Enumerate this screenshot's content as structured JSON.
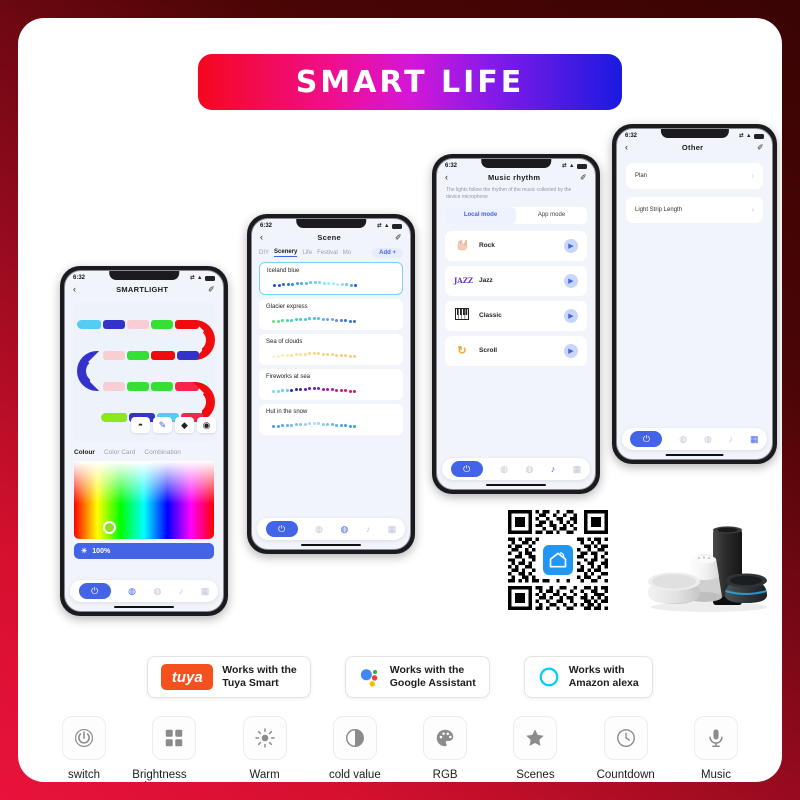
{
  "banner": {
    "title": "SMART LIFE"
  },
  "phone1": {
    "status": {
      "time": "6:32",
      "location_icon": "location-arrow-icon",
      "signal_icon": "signal-icon",
      "wifi_icon": "wifi-icon",
      "battery_icon": "battery-icon"
    },
    "nav": {
      "back": "‹",
      "title": "SMARTLIGHT",
      "edit": "✐"
    },
    "tools": [
      {
        "name": "paint-bucket-tool",
        "glyph": "◓",
        "active": false
      },
      {
        "name": "brush-tool",
        "glyph": "🖌",
        "active": true
      },
      {
        "name": "eraser-tool",
        "glyph": "◆",
        "active": false
      },
      {
        "name": "palette-tool",
        "glyph": "◉",
        "active": false
      }
    ],
    "tabs": [
      {
        "label": "Colour",
        "selected": true
      },
      {
        "label": "Color Card",
        "selected": false
      },
      {
        "label": "Combination",
        "selected": false
      }
    ],
    "brightness": {
      "icon": "sun-icon",
      "value": "100%"
    },
    "tabbar": [
      {
        "name": "power-button",
        "glyph": "⏻",
        "active": true
      },
      {
        "name": "bulb-icon",
        "glyph": "◍",
        "active": true
      },
      {
        "name": "palette-icon",
        "glyph": "◍",
        "active": false
      },
      {
        "name": "music-icon",
        "glyph": "♪",
        "active": false
      },
      {
        "name": "grid-icon",
        "glyph": "▦",
        "active": false
      }
    ],
    "strip_colors": [
      [
        "#55ccf2",
        "#3333cc",
        "#f9cdd3",
        "#33e033",
        "#f00c0c"
      ],
      [
        "#f9cdd3",
        "#33e033",
        "#f00c0c",
        "#3333cc"
      ],
      [
        "#f9cdd3",
        "#33e033",
        "#33e033",
        "#f4264a"
      ],
      [
        "#8ce81c",
        "#3333cc",
        "#55ccf2",
        "#f4264a"
      ]
    ]
  },
  "phone2": {
    "status": {
      "time": "6:32"
    },
    "nav": {
      "back": "‹",
      "title": "Scene",
      "edit": "✐"
    },
    "tabs": [
      {
        "label": "DIY",
        "selected": false
      },
      {
        "label": "Scenery",
        "selected": true
      },
      {
        "label": "Life",
        "selected": false
      },
      {
        "label": "Festival",
        "selected": false
      },
      {
        "label": "Mo",
        "selected": false
      }
    ],
    "add_label": "Add +",
    "scenes": [
      {
        "name": "Iceland blue",
        "selected": true,
        "colors": [
          "#1f4fd8",
          "#2356db",
          "#2a63de",
          "#2f72e2",
          "#3684e6",
          "#3f97ea",
          "#48a9ee",
          "#52bbf1",
          "#5dc8f3",
          "#69d4f5",
          "#76def6",
          "#84e6f7",
          "#92ecf8",
          "#a0f0f9",
          "#b0f4fa",
          "#8fd9f2",
          "#6cc0ea",
          "#49a7e2",
          "#2356db"
        ]
      },
      {
        "name": "Glacier express",
        "selected": false,
        "colors": [
          "#6fe07a",
          "#63dd85",
          "#57da92",
          "#4bd79f",
          "#45d4ac",
          "#40d1b9",
          "#3ecec6",
          "#40cbd2",
          "#45c6dc",
          "#4cc0e3",
          "#54b8e7",
          "#5fb0ea",
          "#6aa6ec",
          "#7a9cee",
          "#5c8ae8",
          "#4a7be4",
          "#3b6ee0",
          "#3b6ee0",
          "#3b6ee0"
        ]
      },
      {
        "name": "Sea of clouds",
        "selected": false,
        "colors": [
          "#fdf3cf",
          "#fcefc2",
          "#fbebb5",
          "#fbe7aa",
          "#fae4a1",
          "#fae199",
          "#f9de92",
          "#f9dc8c",
          "#f8d987",
          "#f8d783",
          "#f7d580",
          "#f7d47e",
          "#f6d27c",
          "#f6d17b",
          "#f5d07a",
          "#f5cf79",
          "#f4ce78",
          "#f4cd78",
          "#f3cc77"
        ]
      },
      {
        "name": "Fireworks at sea",
        "selected": false,
        "colors": [
          "#79dcf0",
          "#6fd6ee",
          "#63cfec",
          "#57c8ea",
          "#2a2ad0",
          "#2820cd",
          "#3a1fc9",
          "#4c1ec5",
          "#5f1dc1",
          "#711cbc",
          "#841bb8",
          "#961ab3",
          "#a919ae",
          "#bb18a8",
          "#c4179c",
          "#cc168c",
          "#d4157a",
          "#dc1465",
          "#e31350"
        ]
      },
      {
        "name": "Hut in the snow",
        "selected": false,
        "colors": [
          "#3f9be0",
          "#49a3e3",
          "#54abe6",
          "#5fb3e9",
          "#6bbbeb",
          "#78c3ed",
          "#86caef",
          "#94d1f1",
          "#a3d8f3",
          "#b2def4",
          "#a0d6f1",
          "#8ecdee",
          "#7cc4eb",
          "#6abbe8",
          "#58b2e5",
          "#46a9e2",
          "#3ba0df",
          "#3ba0df",
          "#3ba0df"
        ]
      }
    ],
    "tabbar": [
      {
        "name": "power-button",
        "glyph": "⏻",
        "active": true
      },
      {
        "name": "bulb-icon",
        "glyph": "◍",
        "active": false
      },
      {
        "name": "palette-icon",
        "glyph": "◍",
        "active": true
      },
      {
        "name": "music-icon",
        "glyph": "♪",
        "active": false
      },
      {
        "name": "grid-icon",
        "glyph": "▦",
        "active": false
      }
    ]
  },
  "phone3": {
    "status": {
      "time": "6:32"
    },
    "nav": {
      "back": "‹",
      "title": "Music rhythm",
      "edit": "✐"
    },
    "description": "The lights follow the rhythm of the music collected by the device microphone",
    "modes": [
      {
        "label": "Local mode",
        "selected": true
      },
      {
        "label": "App mode",
        "selected": false
      }
    ],
    "items": [
      {
        "name": "Rock",
        "icon": "rock-hand-icon",
        "glyph": "🤘",
        "play": "▶"
      },
      {
        "name": "Jazz",
        "icon": "jazz-text-icon",
        "glyph": "JAZZ",
        "play": "▶"
      },
      {
        "name": "Classic",
        "icon": "piano-icon",
        "glyph": "🎹",
        "play": "▶"
      },
      {
        "name": "Scroll",
        "icon": "refresh-icon",
        "glyph": "↻",
        "play": "▶"
      }
    ],
    "tabbar": [
      {
        "name": "power-button",
        "glyph": "⏻",
        "active": true
      },
      {
        "name": "bulb-icon",
        "glyph": "◍",
        "active": false
      },
      {
        "name": "palette-icon",
        "glyph": "◍",
        "active": false
      },
      {
        "name": "music-icon",
        "glyph": "♪",
        "active": true
      },
      {
        "name": "grid-icon",
        "glyph": "▦",
        "active": false
      }
    ]
  },
  "phone4": {
    "status": {
      "time": "6:32"
    },
    "nav": {
      "back": "‹",
      "title": "Other",
      "edit": "✐"
    },
    "rows": [
      {
        "label": "Plan",
        "chevron": "›"
      },
      {
        "label": "Light Strip Length",
        "chevron": "›"
      }
    ],
    "tabbar": [
      {
        "name": "power-button",
        "glyph": "⏻",
        "active": true
      },
      {
        "name": "bulb-icon",
        "glyph": "◍",
        "active": false
      },
      {
        "name": "palette-icon",
        "glyph": "◍",
        "active": false
      },
      {
        "name": "music-icon",
        "glyph": "♪",
        "active": false
      },
      {
        "name": "grid-icon",
        "glyph": "▦",
        "active": true
      }
    ]
  },
  "qr": {
    "name": "qr-code",
    "logo_icon": "smart-life-home-icon"
  },
  "speakers": {
    "name": "smart-speakers-image"
  },
  "badges": [
    {
      "logo": "tuya-logo",
      "logo_text": "tuya",
      "line1": "Works  with the",
      "line2": "Tuya Smart"
    },
    {
      "logo": "google-assistant-logo",
      "line1": "Works  with the",
      "line2": "Google Assistant"
    },
    {
      "logo": "amazon-alexa-logo",
      "line1": "Works with",
      "line2": "Amazon alexa"
    }
  ],
  "features": [
    {
      "label": "switch",
      "icon": "power-icon"
    },
    {
      "label": "Brightness value",
      "icon": "grid-icon"
    },
    {
      "label": "Warm",
      "icon": "sun-icon"
    },
    {
      "label": "cold value",
      "icon": "contrast-icon"
    },
    {
      "label": "RGB",
      "icon": "palette-icon"
    },
    {
      "label": "Scenes",
      "icon": "star-icon"
    },
    {
      "label": "Countdown",
      "icon": "clock-icon"
    },
    {
      "label": "Music",
      "icon": "microphone-icon"
    }
  ],
  "colors": {
    "accent": "#4464e8",
    "frame_red": "#e8123c",
    "frame_dark": "#4a0505",
    "tuya_orange": "#f4511e"
  }
}
